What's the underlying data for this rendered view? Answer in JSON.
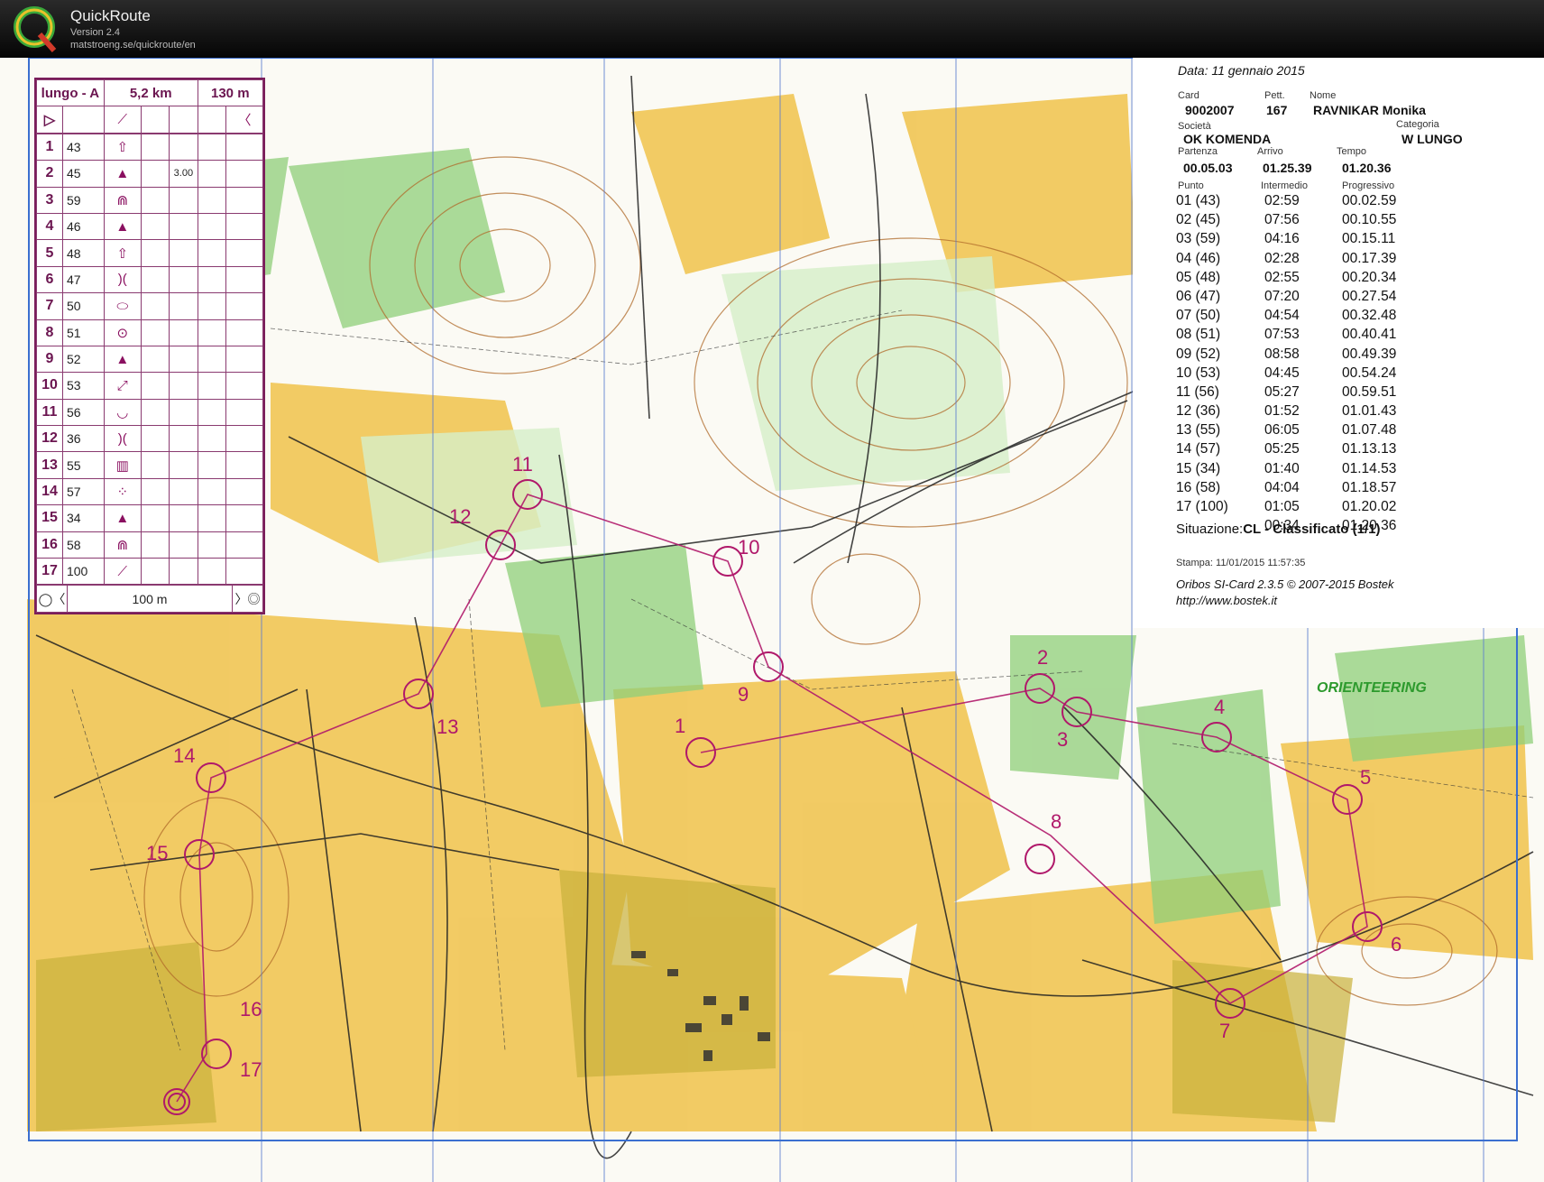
{
  "app": {
    "name": "QuickRoute",
    "version": "Version 2.4",
    "url": "matstroeng.se/quickroute/en"
  },
  "description_sheet": {
    "header": {
      "class": "lungo - A",
      "length": "5,2 km",
      "climb": "130 m"
    },
    "controls": [
      {
        "num": "1",
        "code": "43"
      },
      {
        "num": "2",
        "code": "45",
        "extra": "3.00"
      },
      {
        "num": "3",
        "code": "59"
      },
      {
        "num": "4",
        "code": "46"
      },
      {
        "num": "5",
        "code": "48"
      },
      {
        "num": "6",
        "code": "47"
      },
      {
        "num": "7",
        "code": "50"
      },
      {
        "num": "8",
        "code": "51"
      },
      {
        "num": "9",
        "code": "52"
      },
      {
        "num": "10",
        "code": "53"
      },
      {
        "num": "11",
        "code": "56"
      },
      {
        "num": "12",
        "code": "36"
      },
      {
        "num": "13",
        "code": "55"
      },
      {
        "num": "14",
        "code": "57"
      },
      {
        "num": "15",
        "code": "34"
      },
      {
        "num": "16",
        "code": "58"
      },
      {
        "num": "17",
        "code": "100"
      }
    ],
    "footer": "100 m"
  },
  "result_slip": {
    "date": "Data: 11 gennaio 2015",
    "labels": {
      "card": "Card",
      "pett": "Pett.",
      "nome": "Nome",
      "societa": "Società",
      "categoria": "Categoria",
      "partenza": "Partenza",
      "arrivo": "Arrivo",
      "tempo": "Tempo",
      "punto": "Punto",
      "intermedio": "Intermedio",
      "progressivo": "Progressivo"
    },
    "card": "9002007",
    "pett": "167",
    "name": "RAVNIKAR Monika",
    "club": "OK KOMENDA",
    "category": "W LUNGO",
    "start": "00.05.03",
    "finish": "01.25.39",
    "time": "01.20.36",
    "splits": [
      {
        "punto": "01 (43)",
        "inter": "02:59",
        "prog": "00.02.59"
      },
      {
        "punto": "02 (45)",
        "inter": "07:56",
        "prog": "00.10.55"
      },
      {
        "punto": "03 (59)",
        "inter": "04:16",
        "prog": "00.15.11"
      },
      {
        "punto": "04 (46)",
        "inter": "02:28",
        "prog": "00.17.39"
      },
      {
        "punto": "05 (48)",
        "inter": "02:55",
        "prog": "00.20.34"
      },
      {
        "punto": "06 (47)",
        "inter": "07:20",
        "prog": "00.27.54"
      },
      {
        "punto": "07 (50)",
        "inter": "04:54",
        "prog": "00.32.48"
      },
      {
        "punto": "08 (51)",
        "inter": "07:53",
        "prog": "00.40.41"
      },
      {
        "punto": "09 (52)",
        "inter": "08:58",
        "prog": "00.49.39"
      },
      {
        "punto": "10 (53)",
        "inter": "04:45",
        "prog": "00.54.24"
      },
      {
        "punto": "11 (56)",
        "inter": "05:27",
        "prog": "00.59.51"
      },
      {
        "punto": "12 (36)",
        "inter": "01:52",
        "prog": "01.01.43"
      },
      {
        "punto": "13 (55)",
        "inter": "06:05",
        "prog": "01.07.48"
      },
      {
        "punto": "14 (57)",
        "inter": "05:25",
        "prog": "01.13.13"
      },
      {
        "punto": "15 (34)",
        "inter": "01:40",
        "prog": "01.14.53"
      },
      {
        "punto": "16 (58)",
        "inter": "04:04",
        "prog": "01.18.57"
      },
      {
        "punto": "17 (100)",
        "inter": "01:05",
        "prog": "01.20.02"
      },
      {
        "punto": "",
        "inter": "00:34",
        "prog": "01.20.36"
      }
    ],
    "status_label": "Situazione:",
    "status_value": "CL - Classificato (1/1)",
    "stamp": "Stampa: 11/01/2015 11:57:35",
    "software": "Oribos SI-Card 2.3.5 © 2007-2015 Bostek",
    "website": "http://www.bostek.it"
  },
  "brand": "ORIENTEERING",
  "map_labels": [
    "1",
    "2",
    "3",
    "4",
    "5",
    "6",
    "7",
    "8",
    "9",
    "10",
    "11",
    "12",
    "13",
    "14",
    "15",
    "16",
    "17"
  ],
  "colors": {
    "course": "#b0186a",
    "open_land": "#f3c64a",
    "forest": "#ffffff",
    "green": "#7cc36a",
    "titlebar": "#111111"
  }
}
